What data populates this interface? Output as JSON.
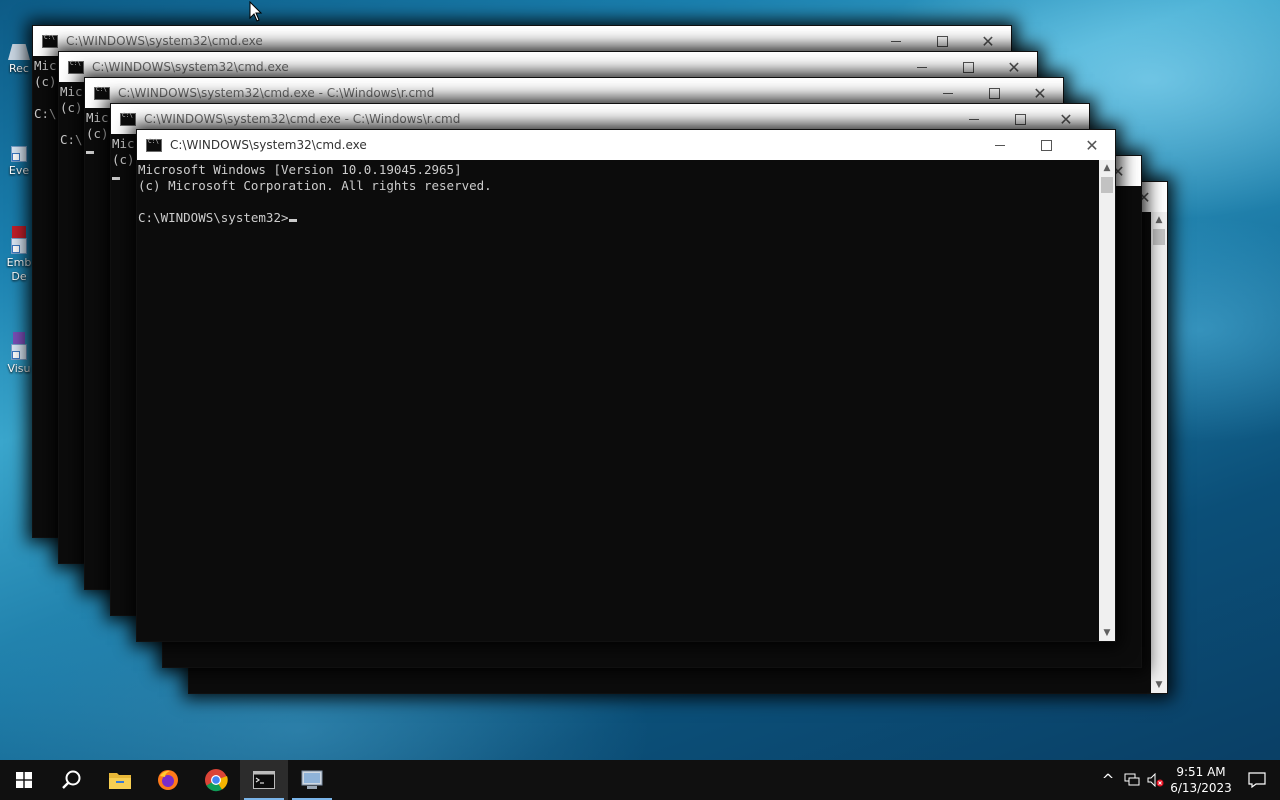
{
  "desktop": {
    "icons": [
      {
        "name": "recycle-bin",
        "label": "Rec"
      },
      {
        "name": "event-viewer",
        "label": "Eve"
      },
      {
        "name": "embarcadero",
        "label": "Emb De"
      },
      {
        "name": "visual-studio",
        "label": "Visu"
      }
    ]
  },
  "windows": [
    {
      "title": "C:\\WINDOWS\\system32\\cmd.exe",
      "lines": [
        "Mic",
        "(c)",
        "",
        "C:\\"
      ]
    },
    {
      "title": "C:\\WINDOWS\\system32\\cmd.exe",
      "lines": [
        "Mic",
        "(c)",
        "",
        "C:\\"
      ]
    },
    {
      "title": "C:\\WINDOWS\\system32\\cmd.exe - C:\\Windows\\r.cmd",
      "lines": [
        "Mic",
        "(c)"
      ]
    },
    {
      "title": "C:\\WINDOWS\\system32\\cmd.exe - C:\\Windows\\r.cmd",
      "lines": [
        "Mic",
        "(c)"
      ]
    },
    {
      "title": "C:\\WINDOWS\\system32\\cmd.exe",
      "lines": [
        "Microsoft Windows [Version 10.0.19045.2965]",
        "(c) Microsoft Corporation. All rights reserved.",
        "",
        "C:\\WINDOWS\\system32>"
      ]
    }
  ],
  "controls": {
    "close_glyph": "✕",
    "scroll_up": "▲",
    "scroll_down": "▼"
  },
  "taskbar": {
    "apps": [
      "start",
      "search",
      "file-explorer",
      "firefox",
      "chrome",
      "command-prompt",
      "control-panel"
    ],
    "tray": {
      "chevron": "^",
      "time": "9:51 AM",
      "date": "6/13/2023"
    }
  },
  "colors": {
    "accent": "#7ab4e8",
    "console_bg": "#0c0c0c",
    "console_fg": "#cccccc"
  }
}
